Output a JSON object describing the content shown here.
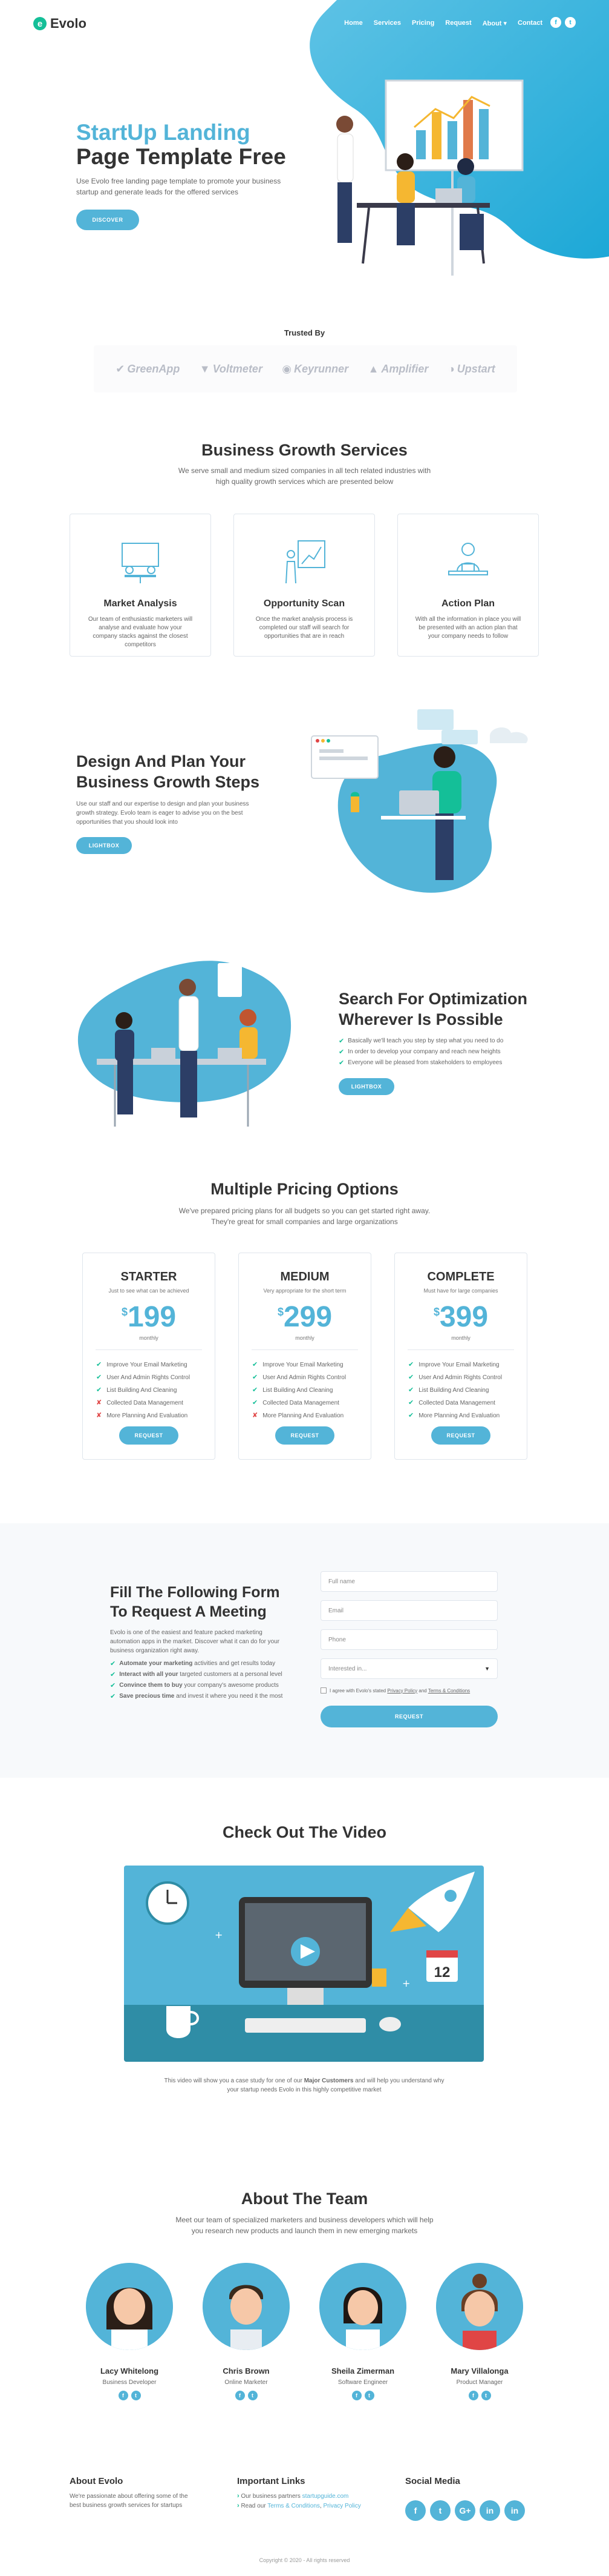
{
  "colors": {
    "accent": "#53b4d8",
    "green": "#14bf98",
    "dark": "#333333",
    "red": "#e04545"
  },
  "nav": {
    "logo_mark": "e",
    "logo_text": "Evolo",
    "links": [
      "Home",
      "Services",
      "Pricing",
      "Request",
      "About ▾",
      "Contact"
    ],
    "social": [
      "f",
      "t"
    ]
  },
  "hero": {
    "title_line1": "StartUp Landing",
    "title_line2": "Page Template Free",
    "text": "Use Evolo free landing page template to promote your business startup and generate leads for the offered services",
    "button": "DISCOVER"
  },
  "trusted": {
    "title": "Trusted By",
    "logos": [
      "GreenApp",
      "Voltmeter",
      "Keyrunner",
      "Amplifier",
      "Upstart"
    ]
  },
  "services": {
    "title": "Business Growth Services",
    "subtitle_line1": "We serve small and medium sized companies in all tech related industries with",
    "subtitle_line2": "high quality growth services which are presented below",
    "cards": [
      {
        "icon": "meeting-icon",
        "title": "Market Analysis",
        "text": "Our team of enthusiastic marketers will analyse and evaluate how your company stacks against the closest competitors"
      },
      {
        "icon": "chart-growth-icon",
        "title": "Opportunity Scan",
        "text": "Once the market analysis process is completed our staff will search for opportunities that are in reach"
      },
      {
        "icon": "person-desk-icon",
        "title": "Action Plan",
        "text": "With all the information in place you will be presented with an action plan that your company needs to follow"
      }
    ]
  },
  "design": {
    "title_line1": "Design And Plan Your",
    "title_line2": "Business Growth Steps",
    "text": "Use our staff and our expertise to design and plan your business growth strategy. Evolo team is eager to advise you on the best opportunities that you should look into",
    "button": "LIGHTBOX"
  },
  "optimize": {
    "title_line1": "Search For Optimization",
    "title_line2": "Wherever Is Possible",
    "items": [
      "Basically we'll teach you step by step what you need to do",
      "In order to develop your company and reach new heights",
      "Everyone will be pleased from stakeholders to employees"
    ],
    "button": "LIGHTBOX"
  },
  "pricing": {
    "title": "Multiple Pricing Options",
    "subtitle_line1": "We've prepared pricing plans for all budgets so you can get started right away.",
    "subtitle_line2": "They're great for small companies and large organizations",
    "plans": [
      {
        "title": "STARTER",
        "sub": "Just to see what can be achieved",
        "currency": "$",
        "price": "199",
        "period": "monthly",
        "features": [
          {
            "text": "Improve Your Email Marketing",
            "ok": true
          },
          {
            "text": "User And Admin Rights Control",
            "ok": true
          },
          {
            "text": "List Building And Cleaning",
            "ok": true
          },
          {
            "text": "Collected Data Management",
            "ok": false
          },
          {
            "text": "More Planning And Evaluation",
            "ok": false
          }
        ],
        "button": "REQUEST"
      },
      {
        "title": "MEDIUM",
        "sub": "Very appropriate for the short term",
        "currency": "$",
        "price": "299",
        "period": "monthly",
        "features": [
          {
            "text": "Improve Your Email Marketing",
            "ok": true
          },
          {
            "text": "User And Admin Rights Control",
            "ok": true
          },
          {
            "text": "List Building And Cleaning",
            "ok": true
          },
          {
            "text": "Collected Data Management",
            "ok": true
          },
          {
            "text": "More Planning And Evaluation",
            "ok": false
          }
        ],
        "button": "REQUEST"
      },
      {
        "title": "COMPLETE",
        "sub": "Must have for large companies",
        "currency": "$",
        "price": "399",
        "period": "monthly",
        "features": [
          {
            "text": "Improve Your Email Marketing",
            "ok": true
          },
          {
            "text": "User And Admin Rights Control",
            "ok": true
          },
          {
            "text": "List Building And Cleaning",
            "ok": true
          },
          {
            "text": "Collected Data Management",
            "ok": true
          },
          {
            "text": "More Planning And Evaluation",
            "ok": true
          }
        ],
        "button": "REQUEST"
      }
    ]
  },
  "request": {
    "title_line1": "Fill The Following Form",
    "title_line2": "To Request A Meeting",
    "text": "Evolo is one of the easiest and feature packed marketing automation apps in the market. Discover what it can do for your business organization right away.",
    "items": [
      {
        "bold": "Automate your marketing",
        "rest": " activities and get results today"
      },
      {
        "bold": "Interact with all your",
        "rest": " targeted customers at a personal level"
      },
      {
        "bold": "Convince them to buy",
        "rest": " your company's awesome products"
      },
      {
        "bold": "Save precious time",
        "rest": " and invest it where you need it the most"
      }
    ],
    "form": {
      "full_name": "Full name",
      "email": "Email",
      "phone": "Phone",
      "interested": "Interested in...",
      "terms_prefix": "I agree with Evolo's stated ",
      "privacy": "Privacy Policy",
      "and": " and ",
      "terms": "Terms & Conditions",
      "button": "REQUEST"
    }
  },
  "video": {
    "title": "Check Out The Video",
    "calendar_day": "12",
    "caption_pre": "This video will show you a case study for one of our ",
    "caption_bold": "Major Customers",
    "caption_post": " and will help you understand why your startup needs Evolo in this highly competitive market"
  },
  "team": {
    "title": "About The Team",
    "subtitle_line1": "Meet our team of specialized marketers and business developers which will help",
    "subtitle_line2": "you research new products and launch them in new emerging markets",
    "members": [
      {
        "name": "Lacy Whitelong",
        "role": "Business Developer"
      },
      {
        "name": "Chris Brown",
        "role": "Online Marketer"
      },
      {
        "name": "Sheila Zimerman",
        "role": "Software Engineer"
      },
      {
        "name": "Mary Villalonga",
        "role": "Product Manager"
      }
    ]
  },
  "footer": {
    "about_title": "About Evolo",
    "about_text": "We're passionate about offering some of the best business growth services for startups",
    "links_title": "Important Links",
    "link1_pre": "Our business partners ",
    "link1": "startupguide.com",
    "link2_pre": "Read our ",
    "link2": "Terms & Conditions",
    "link2_mid": ", ",
    "link3": "Privacy Policy",
    "social_title": "Social Media",
    "social": [
      "f",
      "t",
      "G+",
      "in",
      "in"
    ],
    "copyright": "Copyright © 2020 - All rights reserved"
  }
}
